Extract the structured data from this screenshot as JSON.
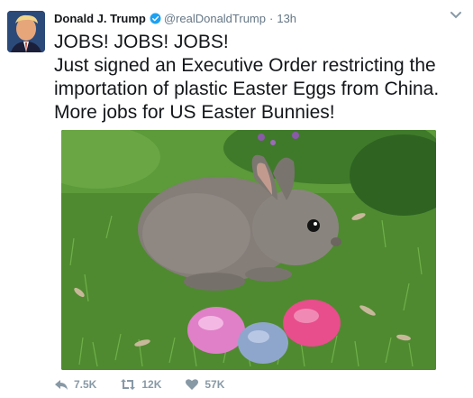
{
  "tweet": {
    "author_name": "Donald J. Trump",
    "handle": "@realDonaldTrump",
    "separator": "·",
    "time": "13h",
    "text": "JOBS! JOBS! JOBS!\nJust signed an Executive Order restricting the importation of plastic Easter Eggs from China. More jobs for US Easter Bunnies!",
    "icons": {
      "avatar": "profile-photo",
      "verified": "verified-badge-icon",
      "more": "chevron-down-icon",
      "reply": "reply-icon",
      "retweet": "retweet-icon",
      "like": "heart-icon"
    },
    "colors": {
      "verified_blue": "#1da1f2",
      "muted": "#8899a6",
      "text": "#14171a"
    }
  },
  "actions": {
    "reply_count": "7.5K",
    "retweet_count": "12K",
    "like_count": "57K"
  }
}
